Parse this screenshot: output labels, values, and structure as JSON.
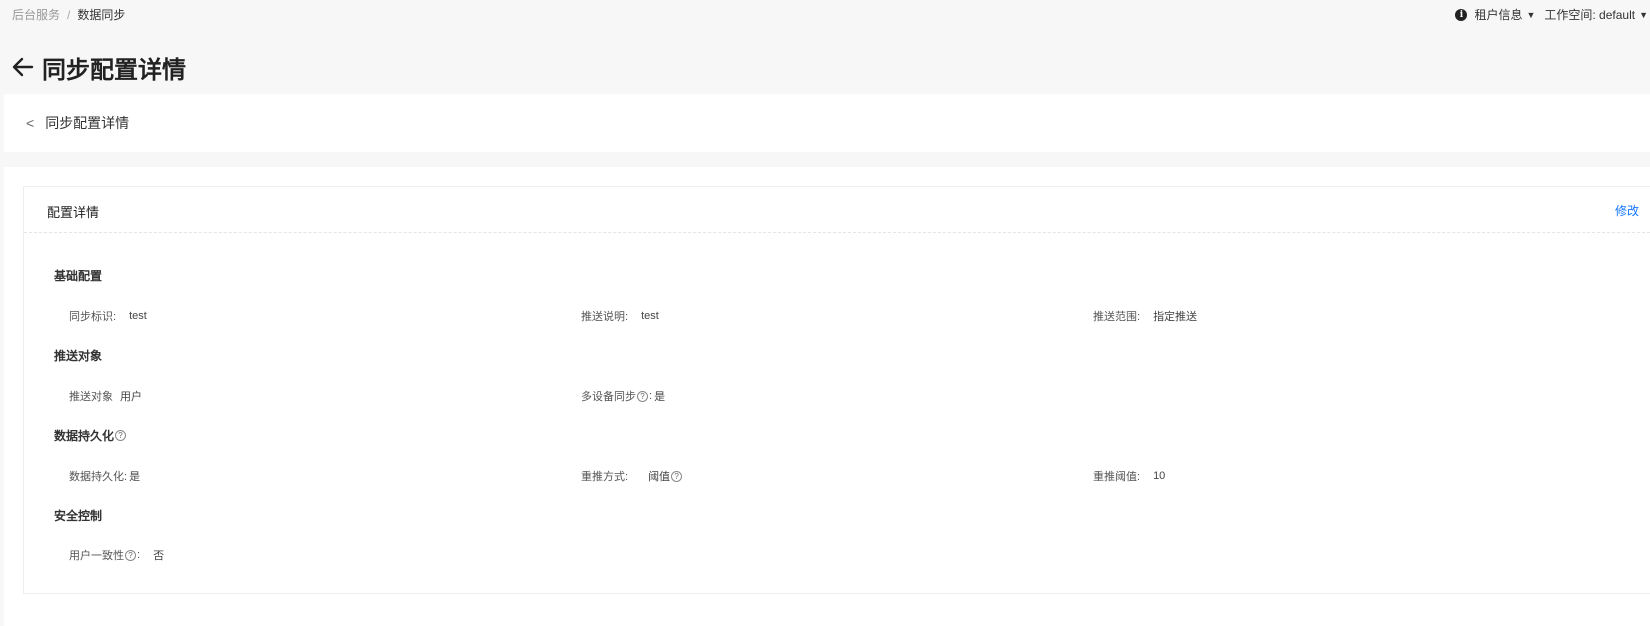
{
  "breadcrumb": {
    "parent": "后台服务",
    "separator": "/",
    "current": "数据同步"
  },
  "topbar": {
    "tenant_label": "租户信息",
    "workspace_label": "工作空间: default"
  },
  "page": {
    "title": "同步配置详情"
  },
  "subheader": {
    "back_glyph": "<",
    "title": "同步配置详情"
  },
  "card": {
    "title": "配置详情",
    "edit_label": "修改",
    "sections": {
      "basic": {
        "title": "基础配置",
        "sync_id_label": "同步标识:",
        "sync_id_value": "test",
        "push_desc_label": "推送说明:",
        "push_desc_value": "test",
        "push_scope_label": "推送范围:",
        "push_scope_value": "指定推送"
      },
      "target": {
        "title": "推送对象",
        "push_target_label": "推送对象",
        "push_target_value": "用户",
        "multi_device_label": "多设备同步",
        "multi_device_suffix": ":",
        "multi_device_value": "是"
      },
      "persistence": {
        "title": "数据持久化",
        "persist_label": "数据持久化:",
        "persist_value": "是",
        "retry_mode_label": "重推方式:",
        "retry_mode_value": "阈值",
        "retry_threshold_label": "重推阈值:",
        "retry_threshold_value": "10"
      },
      "security": {
        "title": "安全控制",
        "consistency_label": "用户一致性",
        "consistency_suffix": ":",
        "consistency_value": "否"
      }
    }
  },
  "icons": {
    "info": "info-icon",
    "caret": "caret-down-icon",
    "back": "arrow-left-icon",
    "help": "question-circle-icon"
  },
  "colors": {
    "link": "#1677ff",
    "background": "#f7f7f7"
  }
}
